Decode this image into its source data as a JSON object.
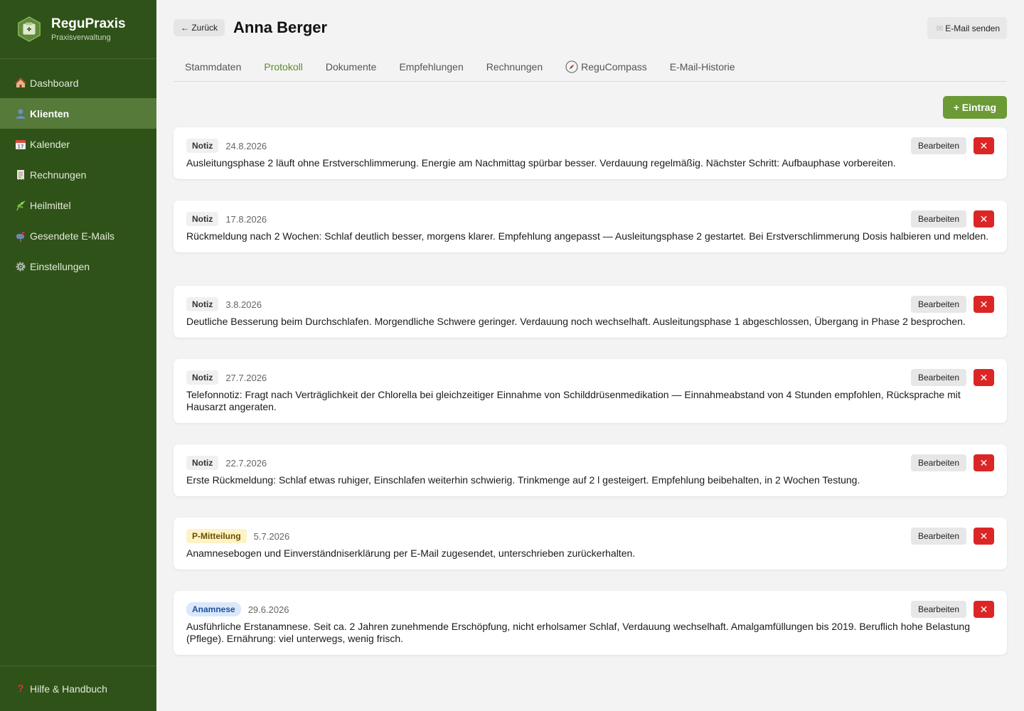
{
  "app": {
    "name": "ReguPraxis",
    "subtitle": "Praxisverwaltung"
  },
  "sidebar": {
    "items": [
      {
        "label": "Dashboard",
        "icon": "house-icon"
      },
      {
        "label": "Klienten",
        "icon": "person-icon",
        "active": true
      },
      {
        "label": "Kalender",
        "icon": "calendar-icon"
      },
      {
        "label": "Rechnungen",
        "icon": "receipt-icon"
      },
      {
        "label": "Heilmittel",
        "icon": "herb-icon"
      },
      {
        "label": "Gesendete E-Mails",
        "icon": "mailbox-icon"
      },
      {
        "label": "Einstellungen",
        "icon": "gear-icon"
      }
    ],
    "footer": {
      "label": "Hilfe & Handbuch",
      "icon": "question-icon"
    }
  },
  "header": {
    "back": "← Zurück",
    "title": "Anna Berger",
    "mail_button": "E-Mail senden"
  },
  "tabs": [
    {
      "label": "Stammdaten"
    },
    {
      "label": "Protokoll",
      "active": true
    },
    {
      "label": "Dokumente"
    },
    {
      "label": "Empfehlungen"
    },
    {
      "label": "Rechnungen"
    },
    {
      "label": "ReguCompass"
    },
    {
      "label": "E-Mail-Historie"
    }
  ],
  "toolbar": {
    "add_label": "+ Eintrag"
  },
  "entry_actions": {
    "edit": "Bearbeiten",
    "delete": "✕"
  },
  "entries": [
    {
      "type": "Notiz",
      "date": "24.8.2026",
      "text": "Ausleitungsphase 2 läuft ohne Erstverschlimmerung. Energie am Nachmittag spürbar besser. Verdauung regelmäßig. Nächster Schritt: Aufbauphase vorbereiten."
    },
    {
      "type": "Notiz",
      "date": "17.8.2026",
      "text": "Rückmeldung nach 2 Wochen: Schlaf deutlich besser, morgens klarer. Empfehlung angepasst — Ausleitungsphase 2 gestartet. Bei Erstverschlimmerung Dosis halbieren und melden."
    },
    {
      "type": "Notiz",
      "date": "3.8.2026",
      "text": "Deutliche Besserung beim Durchschlafen. Morgendliche Schwere geringer. Verdauung noch wechselhaft. Ausleitungsphase 1 abgeschlossen, Übergang in Phase 2 besprochen."
    },
    {
      "type": "Notiz",
      "date": "27.7.2026",
      "text": "Telefonnotiz: Fragt nach Verträglichkeit der Chlorella bei gleichzeitiger Einnahme von Schilddrüsenmedikation — Einnahmeabstand von 4 Stunden empfohlen, Rücksprache mit Hausarzt angeraten."
    },
    {
      "type": "Notiz",
      "date": "22.7.2026",
      "text": "Erste Rückmeldung: Schlaf etwas ruhiger, Einschlafen weiterhin schwierig. Trinkmenge auf 2 l gesteigert. Empfehlung beibehalten, in 2 Wochen Testung."
    },
    {
      "type": "P-Mitteilung",
      "date": "5.7.2026",
      "text": "Anamnesebogen und Einverständniserklärung per E-Mail zugesendet, unterschrieben zurückerhalten."
    },
    {
      "type": "Anamnese",
      "date": "29.6.2026",
      "text": "Ausführliche Erstanamnese. Seit ca. 2 Jahren zunehmende Erschöpfung, nicht erholsamer Schlaf, Verdauung wechselhaft. Amalgamfüllungen bis 2019. Beruflich hohe Belastung (Pflege). Ernährung: viel unterwegs, wenig frisch."
    }
  ],
  "colors": {
    "sidebar": "#2f5219",
    "sidebar_active": "#557a3a",
    "accent": "#6b9a36",
    "tab_active": "#5d8a2e",
    "danger": "#dc2626"
  }
}
